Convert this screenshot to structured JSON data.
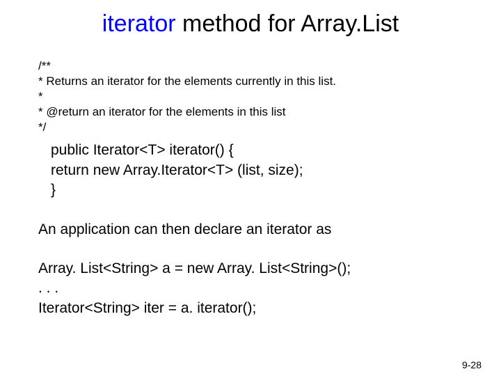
{
  "title": {
    "word1": "iterator",
    "rest": " method for Array.List"
  },
  "comment": {
    "l1": "/**",
    "l2": "* Returns an iterator for the elements currently in this list.",
    "l3": "*",
    "l4": "* @return  an iterator for the elements in this list",
    "l5": "*/"
  },
  "code": {
    "l1": "public Iterator<T> iterator()  {",
    "l2": "   return new Array.Iterator<T> (list, size);",
    "l3": "}"
  },
  "body": "An application can then declare an iterator as",
  "example": {
    "l1": "Array. List<String> a = new Array. List<String>();",
    "l2": ". . .",
    "l3": "Iterator<String> iter = a. iterator();"
  },
  "pagenum": "9-28"
}
